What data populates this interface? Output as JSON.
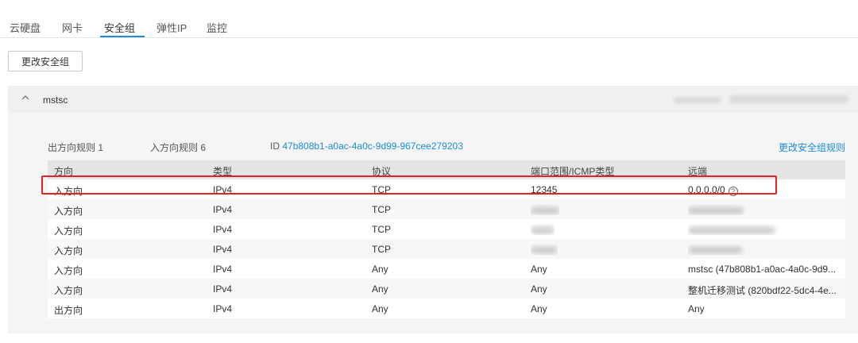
{
  "tabs": [
    {
      "label": "云硬盘",
      "active": false
    },
    {
      "label": "网卡",
      "active": false
    },
    {
      "label": "安全组",
      "active": true
    },
    {
      "label": "弹性IP",
      "active": false
    },
    {
      "label": "监控",
      "active": false
    }
  ],
  "toolbar": {
    "change_sg_label": "更改安全组"
  },
  "security_group": {
    "name": "mstsc",
    "header_right_text": "103 | Nw... ",
    "outbound_label": "出方向规则 1",
    "inbound_label": "入方向规则 6",
    "id_prefix": "ID",
    "id_value": "47b808b1-a0ac-4a0c-9d99-967cee279203",
    "change_rules_label": "更改安全组规则"
  },
  "table": {
    "headers": [
      "方向",
      "类型",
      "协议",
      "端口范围/ICMP类型",
      "远端"
    ],
    "rows": [
      {
        "direction": "入方向",
        "type": "IPv4",
        "protocol": "TCP",
        "port": "12345",
        "remote": "0.0.0.0/0",
        "highlighted": true
      },
      {
        "direction": "入方向",
        "type": "IPv4",
        "protocol": "TCP",
        "port": "",
        "remote": ""
      },
      {
        "direction": "入方向",
        "type": "IPv4",
        "protocol": "TCP",
        "port": "",
        "remote": ""
      },
      {
        "direction": "入方向",
        "type": "IPv4",
        "protocol": "TCP",
        "port": "",
        "remote": ""
      },
      {
        "direction": "入方向",
        "type": "IPv4",
        "protocol": "Any",
        "port": "Any",
        "remote": "mstsc (47b808b1-a0ac-4a0c-9d9..."
      },
      {
        "direction": "入方向",
        "type": "IPv4",
        "protocol": "Any",
        "port": "Any",
        "remote": "整机迁移测试 (820bdf22-5dc4-4e..."
      },
      {
        "direction": "出方向",
        "type": "IPv4",
        "protocol": "Any",
        "port": "Any",
        "remote": "Any"
      }
    ]
  },
  "colors": {
    "accent": "#1a8cd8",
    "highlight_border": "#e0232b"
  }
}
